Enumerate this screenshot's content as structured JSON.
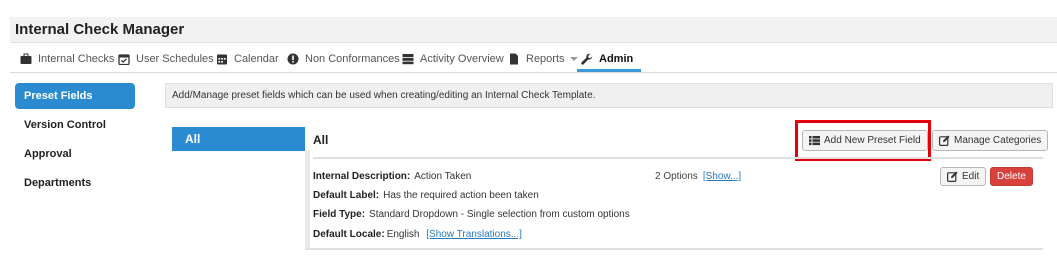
{
  "app": {
    "title": "Internal Check Manager"
  },
  "nav": {
    "items": [
      {
        "label": "Internal Checks",
        "icon": "briefcase-icon"
      },
      {
        "label": "User Schedules",
        "icon": "calendar-check-icon"
      },
      {
        "label": "Calendar",
        "icon": "calendar-icon"
      },
      {
        "label": "Non Conformances",
        "icon": "exclamation-circle-icon"
      },
      {
        "label": "Activity Overview",
        "icon": "server-icon"
      },
      {
        "label": "Reports",
        "icon": "file-icon"
      },
      {
        "label": "Admin",
        "icon": "wrench-icon"
      }
    ],
    "active": "Admin"
  },
  "sidebar": {
    "items": [
      {
        "label": "Preset Fields",
        "active": true
      },
      {
        "label": "Version Control",
        "active": false
      },
      {
        "label": "Approval",
        "active": false
      },
      {
        "label": "Departments",
        "active": false
      }
    ]
  },
  "info": {
    "text": "Add/Manage preset fields which can be used when creating/editing an Internal Check Template."
  },
  "categories": {
    "selected": "All"
  },
  "main": {
    "title": "All",
    "add_button": "Add New Preset Field",
    "manage_button": "Manage Categories"
  },
  "field": {
    "internal_description_label": "Internal Description:",
    "internal_description_value": "Action Taken",
    "default_label_label": "Default Label:",
    "default_label_value": "Has the required action been taken",
    "field_type_label": "Field Type:",
    "field_type_value": "Standard Dropdown - Single selection from custom options",
    "default_locale_label": "Default Locale:",
    "default_locale_value": "English",
    "show_translations_link": "[Show Translations...]",
    "options_count": "2 Options",
    "options_show_link": "[Show...]",
    "edit_button": "Edit",
    "delete_button": "Delete"
  },
  "colors": {
    "accent": "#2a8bd1",
    "highlight": "#e5000b",
    "danger": "#d9413d"
  }
}
